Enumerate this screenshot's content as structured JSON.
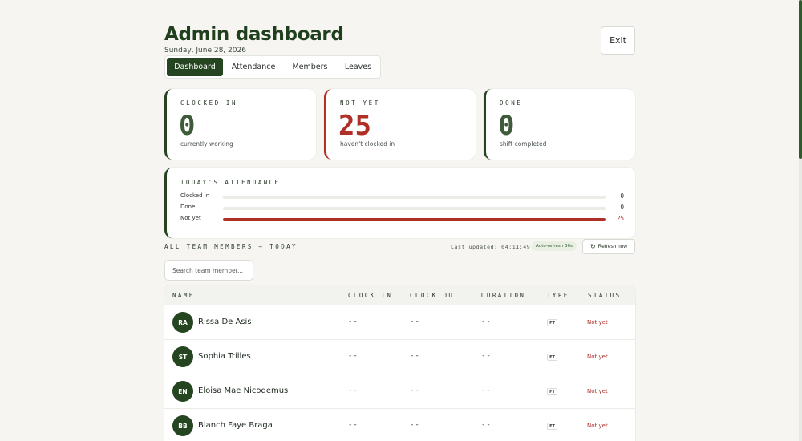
{
  "header": {
    "title": "Admin dashboard",
    "date": "Sunday, June 28, 2026",
    "exit_label": "Exit"
  },
  "tabs": [
    {
      "label": "Dashboard",
      "active": true
    },
    {
      "label": "Attendance",
      "active": false
    },
    {
      "label": "Members",
      "active": false
    },
    {
      "label": "Leaves",
      "active": false
    }
  ],
  "stats": [
    {
      "label": "CLOCKED IN",
      "value": "0",
      "sub": "currently working"
    },
    {
      "label": "NOT YET",
      "value": "25",
      "sub": "haven't clocked in"
    },
    {
      "label": "DONE",
      "value": "0",
      "sub": "shift completed"
    }
  ],
  "attendance": {
    "title": "TODAY'S ATTENDANCE",
    "rows": [
      {
        "label": "Clocked in",
        "value": "0",
        "fraction": 0
      },
      {
        "label": "Done",
        "value": "0",
        "fraction": 0
      },
      {
        "label": "Not yet",
        "value": "25",
        "fraction": 1
      }
    ]
  },
  "members_section": {
    "title": "ALL TEAM MEMBERS — TODAY",
    "last_updated": "Last updated: 04:11:49 PM",
    "auto_refresh": "Auto-refresh 30s",
    "refresh_label": "Refresh now",
    "search_placeholder": "Search team member..."
  },
  "table": {
    "columns": [
      "NAME",
      "CLOCK IN",
      "CLOCK OUT",
      "DURATION",
      "TYPE",
      "STATUS"
    ],
    "rows": [
      {
        "initials": "RA",
        "name": "Rissa De Asis",
        "clock_in": "--",
        "clock_out": "--",
        "duration": "--",
        "type": "FT",
        "status": "Not yet"
      },
      {
        "initials": "ST",
        "name": "Sophia Trilles",
        "clock_in": "--",
        "clock_out": "--",
        "duration": "--",
        "type": "FT",
        "status": "Not yet"
      },
      {
        "initials": "EN",
        "name": "Eloisa Mae Nicodemus",
        "clock_in": "--",
        "clock_out": "--",
        "duration": "--",
        "type": "FT",
        "status": "Not yet"
      },
      {
        "initials": "BB",
        "name": "Blanch Faye Braga",
        "clock_in": "--",
        "clock_out": "--",
        "duration": "--",
        "type": "FT",
        "status": "Not yet"
      }
    ]
  },
  "colors": {
    "accent": "#24451f",
    "alert": "#b03028",
    "background": "#f6f5f2"
  },
  "icons": {
    "refresh": "refresh-icon"
  }
}
